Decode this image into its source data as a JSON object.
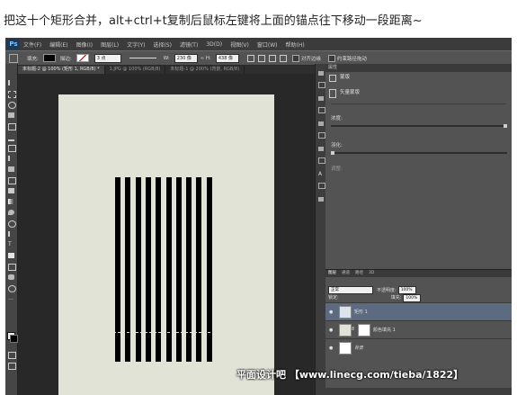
{
  "caption": "把这十个矩形合并，alt+ctrl+t复制后鼠标左键将上面的锚点往下移动一段距离~",
  "app": {
    "logo": "Ps",
    "menu": [
      "文件(F)",
      "编辑(E)",
      "图像(I)",
      "图层(L)",
      "文字(Y)",
      "选择(S)",
      "滤镜(T)",
      "3D(D)",
      "视图(V)",
      "窗口(W)",
      "帮助(H)"
    ]
  },
  "options_bar": {
    "fill_label": "填充:",
    "stroke_label": "描边:",
    "stroke_width": "3 点",
    "w_label": "W:",
    "w_value": "230 像",
    "h_label": "H:",
    "h_value": "438 像",
    "align_edges": "对齐边缘",
    "constrain": "约束路径拖动"
  },
  "tabs": [
    {
      "label": "未标题-2 @ 100% (矩形 1, RGB/8) *",
      "active": true
    },
    {
      "label": "1.JPG @ 100% (RGB/8)",
      "active": false
    },
    {
      "label": "未标题-1 @ 200% (背景, RGB/8)",
      "active": false
    }
  ],
  "canvas": {
    "bar_count": 10,
    "bar_color": "#000000",
    "doc_color": "#e1e3d6"
  },
  "properties": {
    "header": "属性",
    "mask_label": "蒙版",
    "vector_label": "矢量蒙版",
    "density_label": "浓度:",
    "feather_label": "羽化:",
    "refine_label": "调整:"
  },
  "layers_panel": {
    "tabs": [
      "图层",
      "通道",
      "路径",
      "3D"
    ],
    "blend_mode": "正常",
    "opacity_label": "不透明度:",
    "opacity_value": "100%",
    "lock_label": "锁定:",
    "fill_label": "填充:",
    "fill_value": "100%",
    "layers": [
      {
        "name": "矩形 1",
        "selected": true
      },
      {
        "name": "颜色填充 1",
        "selected": false
      },
      {
        "name": "背景",
        "selected": false
      }
    ]
  },
  "watermark": "平面设计吧 【www.linecg.com/tieba/1822】",
  "colors": {
    "accent_selected_layer": "#5d6b80",
    "ui_dark": "#2b2b2b",
    "ui_panel": "#535353"
  }
}
